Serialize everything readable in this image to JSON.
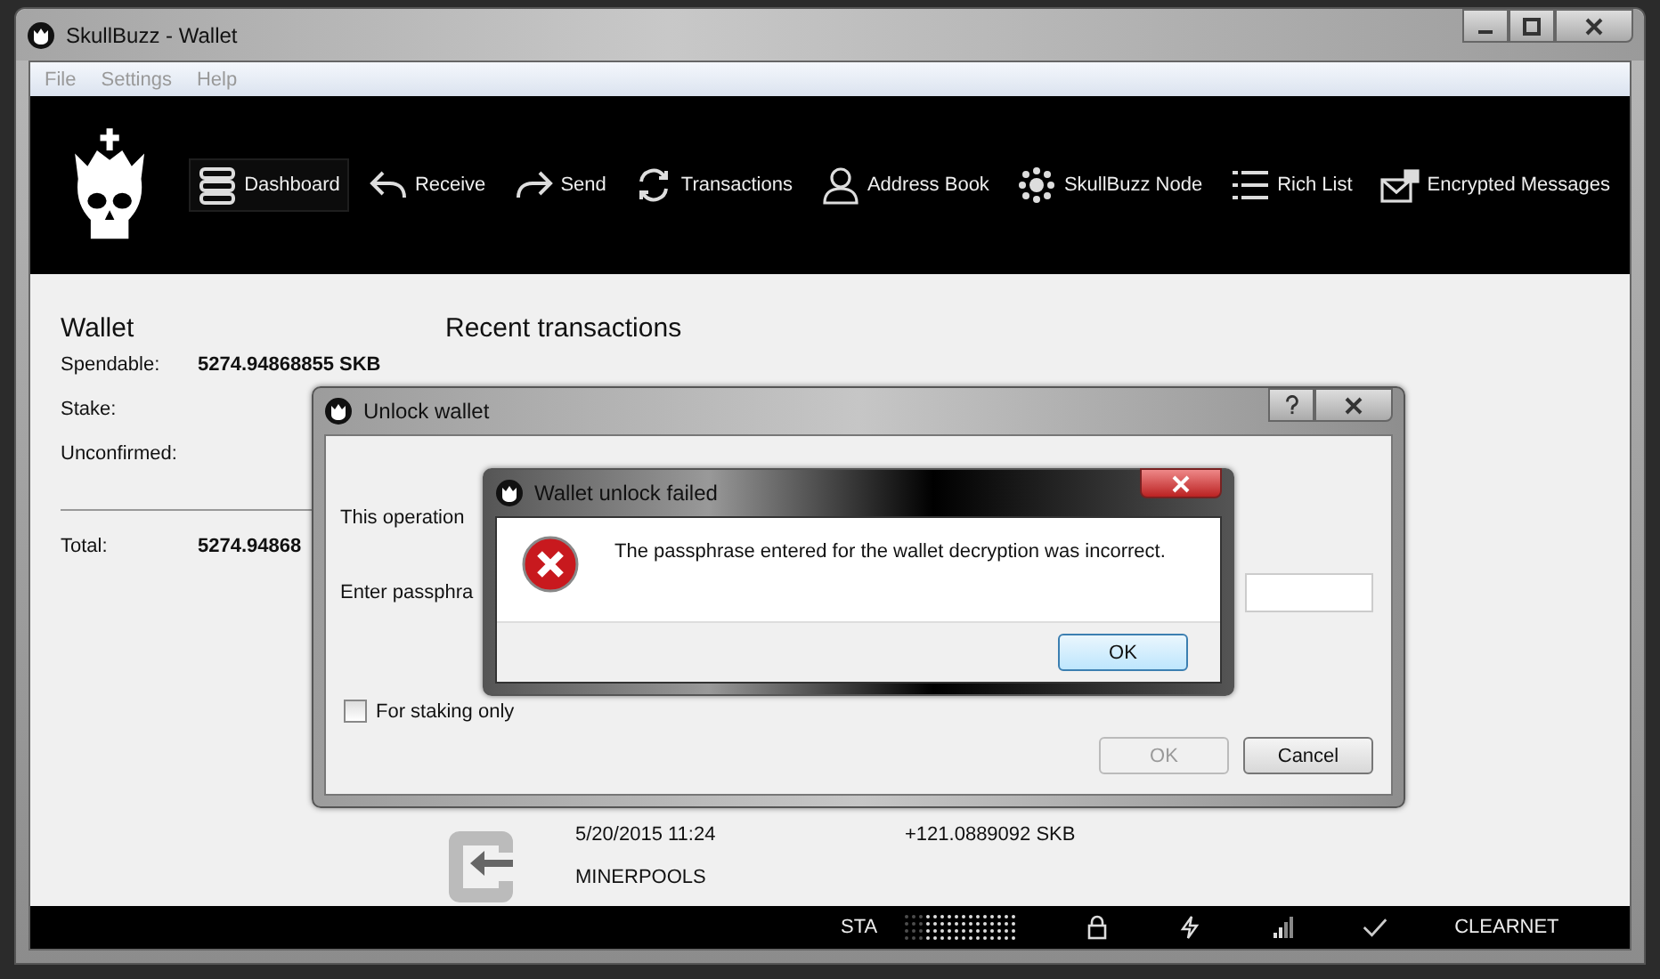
{
  "window": {
    "title": "SkullBuzz - Wallet"
  },
  "menu": [
    "File",
    "Settings",
    "Help"
  ],
  "nav": [
    {
      "label": "Dashboard",
      "selected": true
    },
    {
      "label": "Receive",
      "selected": false
    },
    {
      "label": "Send",
      "selected": false
    },
    {
      "label": "Transactions",
      "selected": false
    },
    {
      "label": "Address Book",
      "selected": false
    },
    {
      "label": "SkullBuzz Node",
      "selected": false
    },
    {
      "label": "Rich List",
      "selected": false
    },
    {
      "label": "Encrypted Messages",
      "selected": false
    }
  ],
  "wallet": {
    "title": "Wallet",
    "rows": [
      {
        "label": "Spendable:",
        "value": "5274.94868855 SKB"
      },
      {
        "label": "Stake:"
      },
      {
        "label": "Unconfirmed:"
      }
    ],
    "total": {
      "label": "Total:",
      "value": "5274.94868"
    }
  },
  "recent": {
    "title": "Recent transactions",
    "transaction": {
      "date": "5/20/2015 11:24",
      "amount": "+121.0889092 SKB",
      "address": "MINERPOOLS"
    }
  },
  "unlock_dialog": {
    "title": "Unlock wallet",
    "message": "This operation",
    "passphrase_label": "Enter passphra",
    "staking_only": {
      "label": "For staking only",
      "checked": false
    },
    "buttons": [
      {
        "label": "OK",
        "disabled": true
      },
      {
        "label": "Cancel",
        "disabled": false
      }
    ]
  },
  "error_dialog": {
    "title": "Wallet unlock failed",
    "message": "The passphrase entered for the wallet decryption was incorrect.",
    "button": "OK"
  },
  "status_bar": {
    "mode": "STA",
    "network": "CLEARNET"
  }
}
